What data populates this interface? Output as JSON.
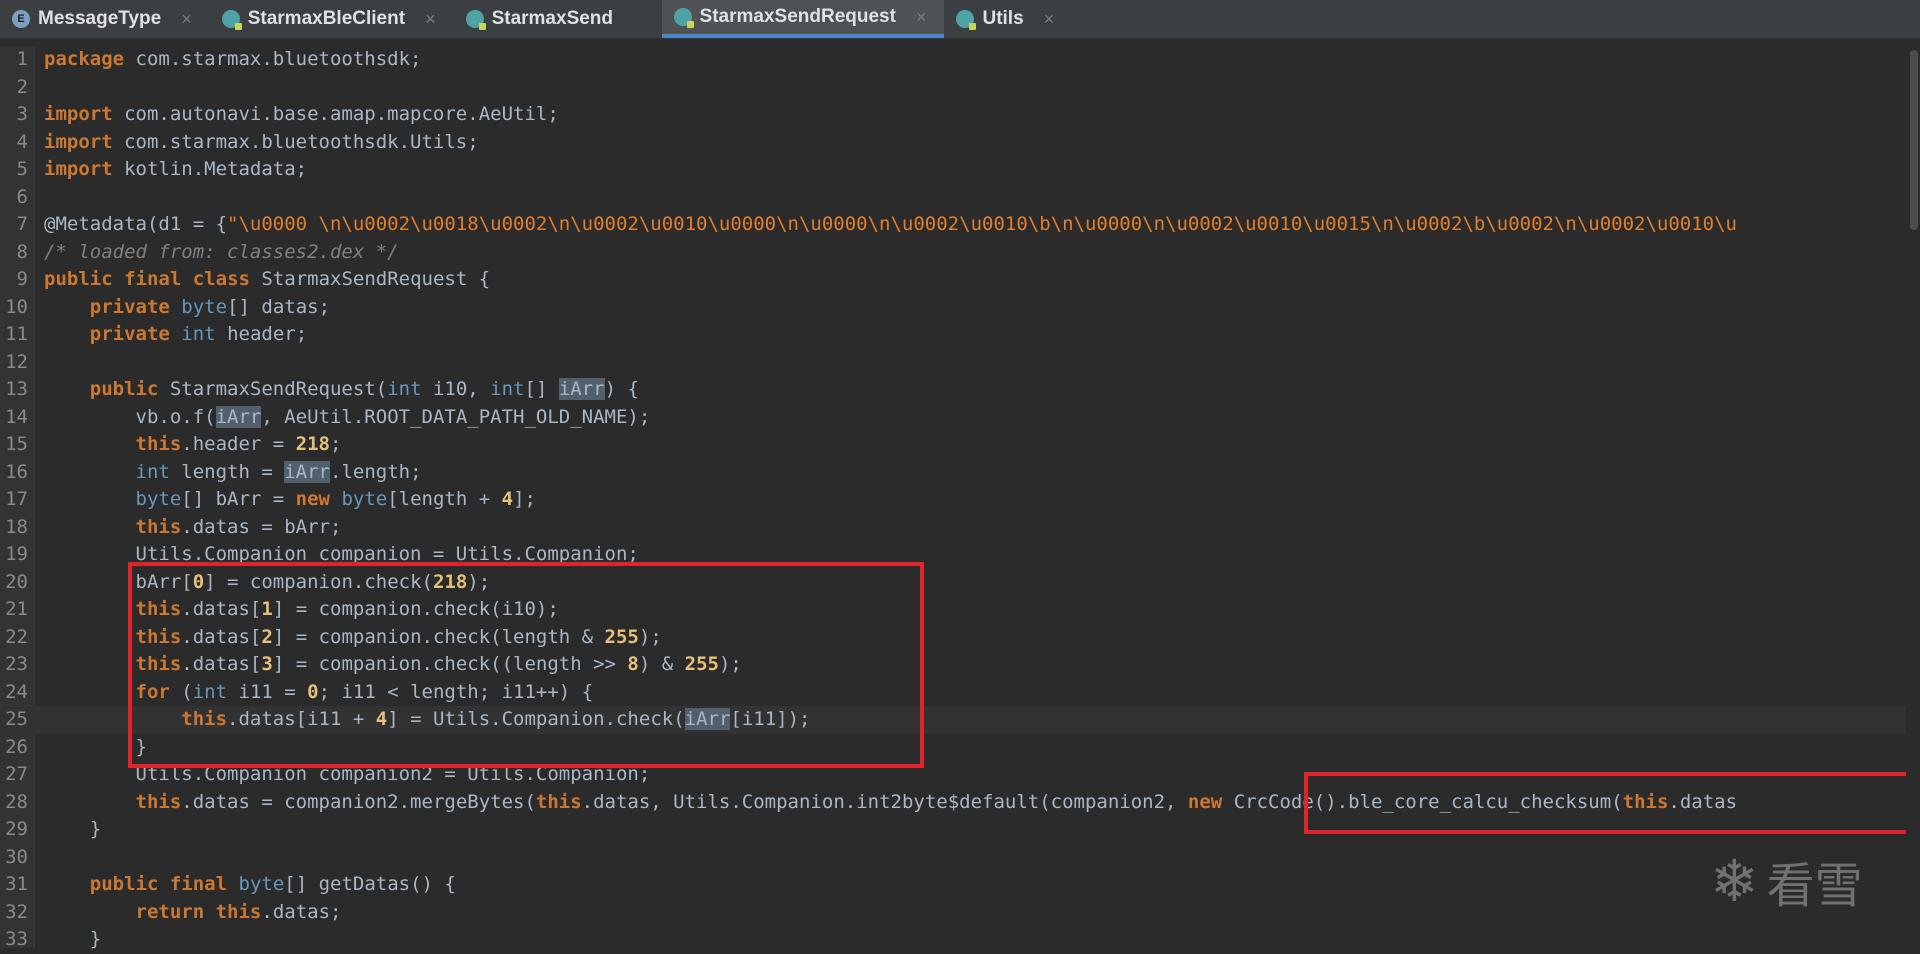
{
  "tabs": [
    {
      "label": "MessageType",
      "icon": "enum-icon",
      "badge": "E",
      "active": false
    },
    {
      "label": "StarmaxBleClient",
      "icon": "class-icon",
      "badge": "C",
      "active": false
    },
    {
      "label": "StarmaxSend",
      "icon": "class-icon",
      "badge": "C",
      "active": false
    },
    {
      "label": "StarmaxSendRequest",
      "icon": "class-icon",
      "badge": "C",
      "active": true
    },
    {
      "label": "Utils",
      "icon": "class-icon",
      "badge": "C",
      "active": false
    }
  ],
  "close_glyph": "×",
  "code": {
    "lines": [
      {
        "n": "1"
      },
      {
        "n": "2"
      },
      {
        "n": "3"
      },
      {
        "n": "4"
      },
      {
        "n": "5"
      },
      {
        "n": "6"
      },
      {
        "n": "7"
      },
      {
        "n": "8"
      },
      {
        "n": "9"
      },
      {
        "n": "10"
      },
      {
        "n": "11"
      },
      {
        "n": "12"
      },
      {
        "n": "13"
      },
      {
        "n": "14"
      },
      {
        "n": "15"
      },
      {
        "n": "16"
      },
      {
        "n": "17"
      },
      {
        "n": "18"
      },
      {
        "n": "19"
      },
      {
        "n": "20"
      },
      {
        "n": "21"
      },
      {
        "n": "22"
      },
      {
        "n": "23"
      },
      {
        "n": "24"
      },
      {
        "n": "25"
      },
      {
        "n": "26"
      },
      {
        "n": "27"
      },
      {
        "n": "28"
      },
      {
        "n": "29"
      },
      {
        "n": "30"
      },
      {
        "n": "31"
      },
      {
        "n": "32"
      },
      {
        "n": "33"
      }
    ],
    "t": {
      "package": "package",
      "pkg_name": " com.starmax.bluetoothsdk;",
      "import": "import",
      "imp1": " com.autonavi.base.amap.mapcore.AeUtil;",
      "imp2": " com.starmax.bluetoothsdk.Utils;",
      "imp3": " kotlin.Metadata;",
      "meta_pre": "@Metadata(d1 = {",
      "meta_str": "\"\\u0000 \\n\\u0002\\u0018\\u0002\\n\\u0002\\u0010\\u0000\\n\\u0000\\n\\u0002\\u0010\\b\\n\\u0000\\n\\u0002\\u0010\\u0015\\n\\u0002\\b\\u0002\\n\\u0002\\u0010\\u",
      "comment": "/* loaded from: classes2.dex */",
      "public": "public",
      "final": "final",
      "class": "class",
      "private": "private",
      "byte": "byte",
      "int": "int",
      "new": "new",
      "this": "this",
      "for": "for",
      "return": "return",
      "cls_name": " StarmaxSendRequest {",
      "datas_decl": "[] datas;",
      "header_decl": " header;",
      "ctor_name": " StarmaxSendRequest(",
      "i10": " i10, ",
      "iarr": "iArr",
      "ctor_end": ") {",
      "vb": "vb.o.f(",
      "vb_end": ", AeUtil.ROOT_DATA_PATH_OLD_NAME);",
      "header_assign": ".header = ",
      "n218": "218",
      "semi": ";",
      "len_decl": " length = ",
      "len_end": ".length;",
      "barr_decl": "[] bArr = ",
      "len_plus": "[length + ",
      "n4": "4",
      "br_semi": "];",
      "datas_assign": ".datas = bArr;",
      "comp_decl": "Utils.Companion companion = Utils.Companion;",
      "barr0": "bArr[",
      "n0": "0",
      "barr0_end": "] = companion.check(",
      "paren_semi": ");",
      "datas_idx": ".datas[",
      "n1": "1",
      "n2": "2",
      "n3": "3",
      "check_i10": "] = companion.check(i10);",
      "check_len": "] = companion.check(length & ",
      "n255": "255",
      "check_shift": "] = companion.check((length >> ",
      "n8": "8",
      "shift_and": ") & ",
      "for_open": " (",
      "i11_init": " i11 = ",
      "for_end": "; i11 < length; i11++) {",
      "loop_idx": ".datas[i11 + ",
      "loop_check": "] = Utils.Companion.check(",
      "loop_end": "[i11]);",
      "close_brace": "}",
      "comp2_decl": "Utils.Companion companion2 = Utils.Companion;",
      "merge_pre": ".datas = companion2.mergeBytes(",
      "merge_mid": ".datas, Utils.Companion.int2byte$default(companion2, ",
      "crc": " CrcCode().ble_core_calcu_checksum(",
      "datas_tail": ".datas",
      "getdatas": "[] getDatas() {",
      "ret_tail": ".datas;"
    }
  },
  "watermark": {
    "glyph": "❄",
    "text": "看雪"
  }
}
